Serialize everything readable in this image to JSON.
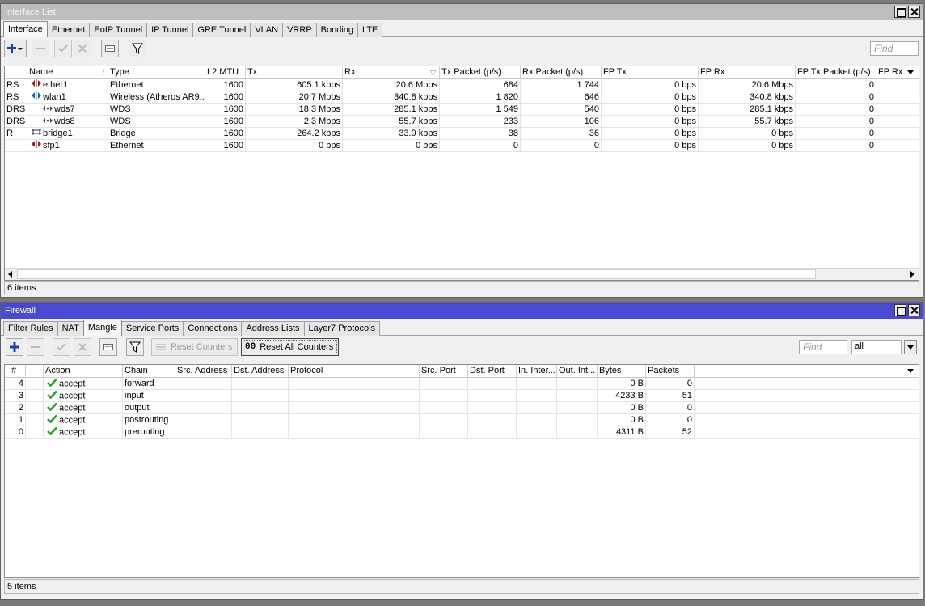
{
  "interface_window": {
    "title": "Interface List",
    "tabs": [
      "Interface",
      "Ethernet",
      "EoIP Tunnel",
      "IP Tunnel",
      "GRE Tunnel",
      "VLAN",
      "VRRP",
      "Bonding",
      "LTE"
    ],
    "active_tab": "Interface",
    "find_placeholder": "Find",
    "columns": [
      "",
      "Name",
      "Type",
      "L2 MTU",
      "Tx",
      "Rx",
      "Tx Packet (p/s)",
      "Rx Packet (p/s)",
      "FP Tx",
      "FP Rx",
      "FP Tx Packet (p/s)",
      "FP Rx P"
    ],
    "rows": [
      {
        "flags": "RS",
        "icon": "ethernet-icon",
        "indent": 0,
        "name": "ether1",
        "type": "Ethernet",
        "l2mtu": "1600",
        "tx": "605.1 kbps",
        "rx": "20.6 Mbps",
        "txp": "684",
        "rxp": "1 744",
        "fptx": "0 bps",
        "fprx": "20.6 Mbps",
        "fptxp": "0"
      },
      {
        "flags": "RS",
        "icon": "wireless-icon",
        "indent": 0,
        "name": "wlan1",
        "type": "Wireless (Atheros AR9...",
        "l2mtu": "1600",
        "tx": "20.7 Mbps",
        "rx": "340.8 kbps",
        "txp": "1 820",
        "rxp": "646",
        "fptx": "0 bps",
        "fprx": "340.8 kbps",
        "fptxp": "0"
      },
      {
        "flags": "DRS",
        "icon": "wds-icon",
        "indent": 1,
        "name": "wds7",
        "type": "WDS",
        "l2mtu": "1600",
        "tx": "18.3 Mbps",
        "rx": "285.1 kbps",
        "txp": "1 549",
        "rxp": "540",
        "fptx": "0 bps",
        "fprx": "285.1 kbps",
        "fptxp": "0"
      },
      {
        "flags": "DRS",
        "icon": "wds-icon",
        "indent": 1,
        "name": "wds8",
        "type": "WDS",
        "l2mtu": "1600",
        "tx": "2.3 Mbps",
        "rx": "55.7 kbps",
        "txp": "233",
        "rxp": "106",
        "fptx": "0 bps",
        "fprx": "55.7 kbps",
        "fptxp": "0"
      },
      {
        "flags": "R",
        "icon": "bridge-icon",
        "indent": 0,
        "name": "bridge1",
        "type": "Bridge",
        "l2mtu": "1600",
        "tx": "264.2 kbps",
        "rx": "33.9 kbps",
        "txp": "38",
        "rxp": "36",
        "fptx": "0 bps",
        "fprx": "0 bps",
        "fptxp": "0"
      },
      {
        "flags": "",
        "icon": "ethernet-icon",
        "indent": 0,
        "name": "sfp1",
        "type": "Ethernet",
        "l2mtu": "1600",
        "tx": "0 bps",
        "rx": "0 bps",
        "txp": "0",
        "rxp": "0",
        "fptx": "0 bps",
        "fprx": "0 bps",
        "fptxp": "0"
      }
    ],
    "status": "6 items"
  },
  "firewall_window": {
    "title": "Firewall",
    "tabs": [
      "Filter Rules",
      "NAT",
      "Mangle",
      "Service Ports",
      "Connections",
      "Address Lists",
      "Layer7 Protocols"
    ],
    "active_tab": "Mangle",
    "reset_counters_label": "Reset Counters",
    "reset_all_counters_label": "Reset All Counters",
    "reset_all_icon_text": "00",
    "find_placeholder": "Find",
    "filter_select_value": "all",
    "columns": [
      "#",
      "",
      "Action",
      "Chain",
      "Src. Address",
      "Dst. Address",
      "Protocol",
      "Src. Port",
      "Dst. Port",
      "In. Inter...",
      "Out. Int...",
      "Bytes",
      "Packets"
    ],
    "rows": [
      {
        "num": "4",
        "action": "accept",
        "chain": "forward",
        "bytes": "0 B",
        "packets": "0"
      },
      {
        "num": "3",
        "action": "accept",
        "chain": "input",
        "bytes": "4233 B",
        "packets": "51"
      },
      {
        "num": "2",
        "action": "accept",
        "chain": "output",
        "bytes": "0 B",
        "packets": "0"
      },
      {
        "num": "1",
        "action": "accept",
        "chain": "postrouting",
        "bytes": "0 B",
        "packets": "0"
      },
      {
        "num": "0",
        "action": "accept",
        "chain": "prerouting",
        "bytes": "4311 B",
        "packets": "52"
      }
    ],
    "status": "5 items"
  },
  "colors": {
    "active_title": "#4a4ad0",
    "inactive_title": "#bdbdbd",
    "accept_check": "#2aa02a",
    "add_plus": "#1a3fb0"
  }
}
